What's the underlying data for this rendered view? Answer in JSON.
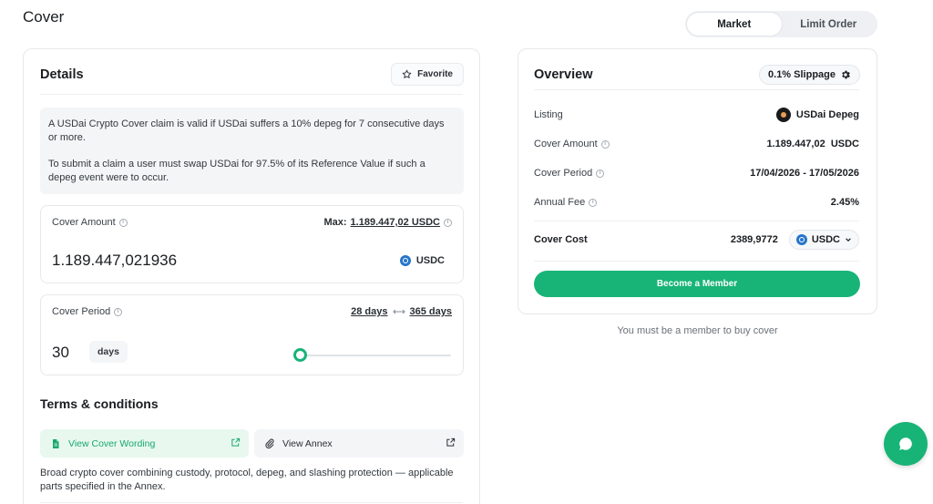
{
  "page": {
    "title": "Cover"
  },
  "order_toggle": {
    "market": "Market",
    "limit": "Limit Order",
    "active": "Market"
  },
  "details": {
    "title": "Details",
    "favorite_label": "Favorite",
    "description_1": "A USDai Crypto Cover claim is valid if USDai suffers a 10% depeg for 7 consecutive days or more.",
    "description_2": "To submit a claim a user must swap USDai for 97.5% of its Reference Value if such a depeg event were to occur.",
    "cover_amount": {
      "label": "Cover Amount",
      "max_prefix": "Max:",
      "max_value": "1.189.447,02 USDC",
      "value": "1.189.447,021936",
      "token": "USDC"
    },
    "cover_period": {
      "label": "Cover Period",
      "min": "28 days",
      "max": "365 days",
      "value": "30",
      "unit": "days",
      "slider_min": 28,
      "slider_max": 365,
      "slider_value": 30
    },
    "terms": {
      "title": "Terms & conditions",
      "wording_label": "View Cover Wording",
      "annex_label": "View Annex",
      "summary": "Broad crypto cover combining custody, protocol, depeg, and slashing protection — applicable parts specified in the Annex."
    }
  },
  "overview": {
    "title": "Overview",
    "slippage": "0.1% Slippage",
    "listing_label": "Listing",
    "listing_value": "USDai Depeg",
    "cover_amount_label": "Cover Amount",
    "cover_amount_value": "1.189.447,02  USDC",
    "cover_period_label": "Cover Period",
    "cover_period_value": "17/04/2026 - 17/05/2026",
    "annual_fee_label": "Annual Fee",
    "annual_fee_value": "2.45%",
    "cover_cost_label": "Cover Cost",
    "cover_cost_value": "2389,9772",
    "cover_cost_currency": "USDC",
    "become_member": "Become a Member"
  },
  "member_note": "You must be a member to buy cover",
  "colors": {
    "accent": "#18b477",
    "usdc": "#2775ca"
  },
  "icons": [
    "star-icon",
    "info-icon",
    "usdc-icon",
    "arrow-range-icon",
    "document-icon",
    "external-link-icon",
    "paperclip-icon",
    "gear-icon",
    "chevron-down-icon",
    "chat-icon"
  ]
}
